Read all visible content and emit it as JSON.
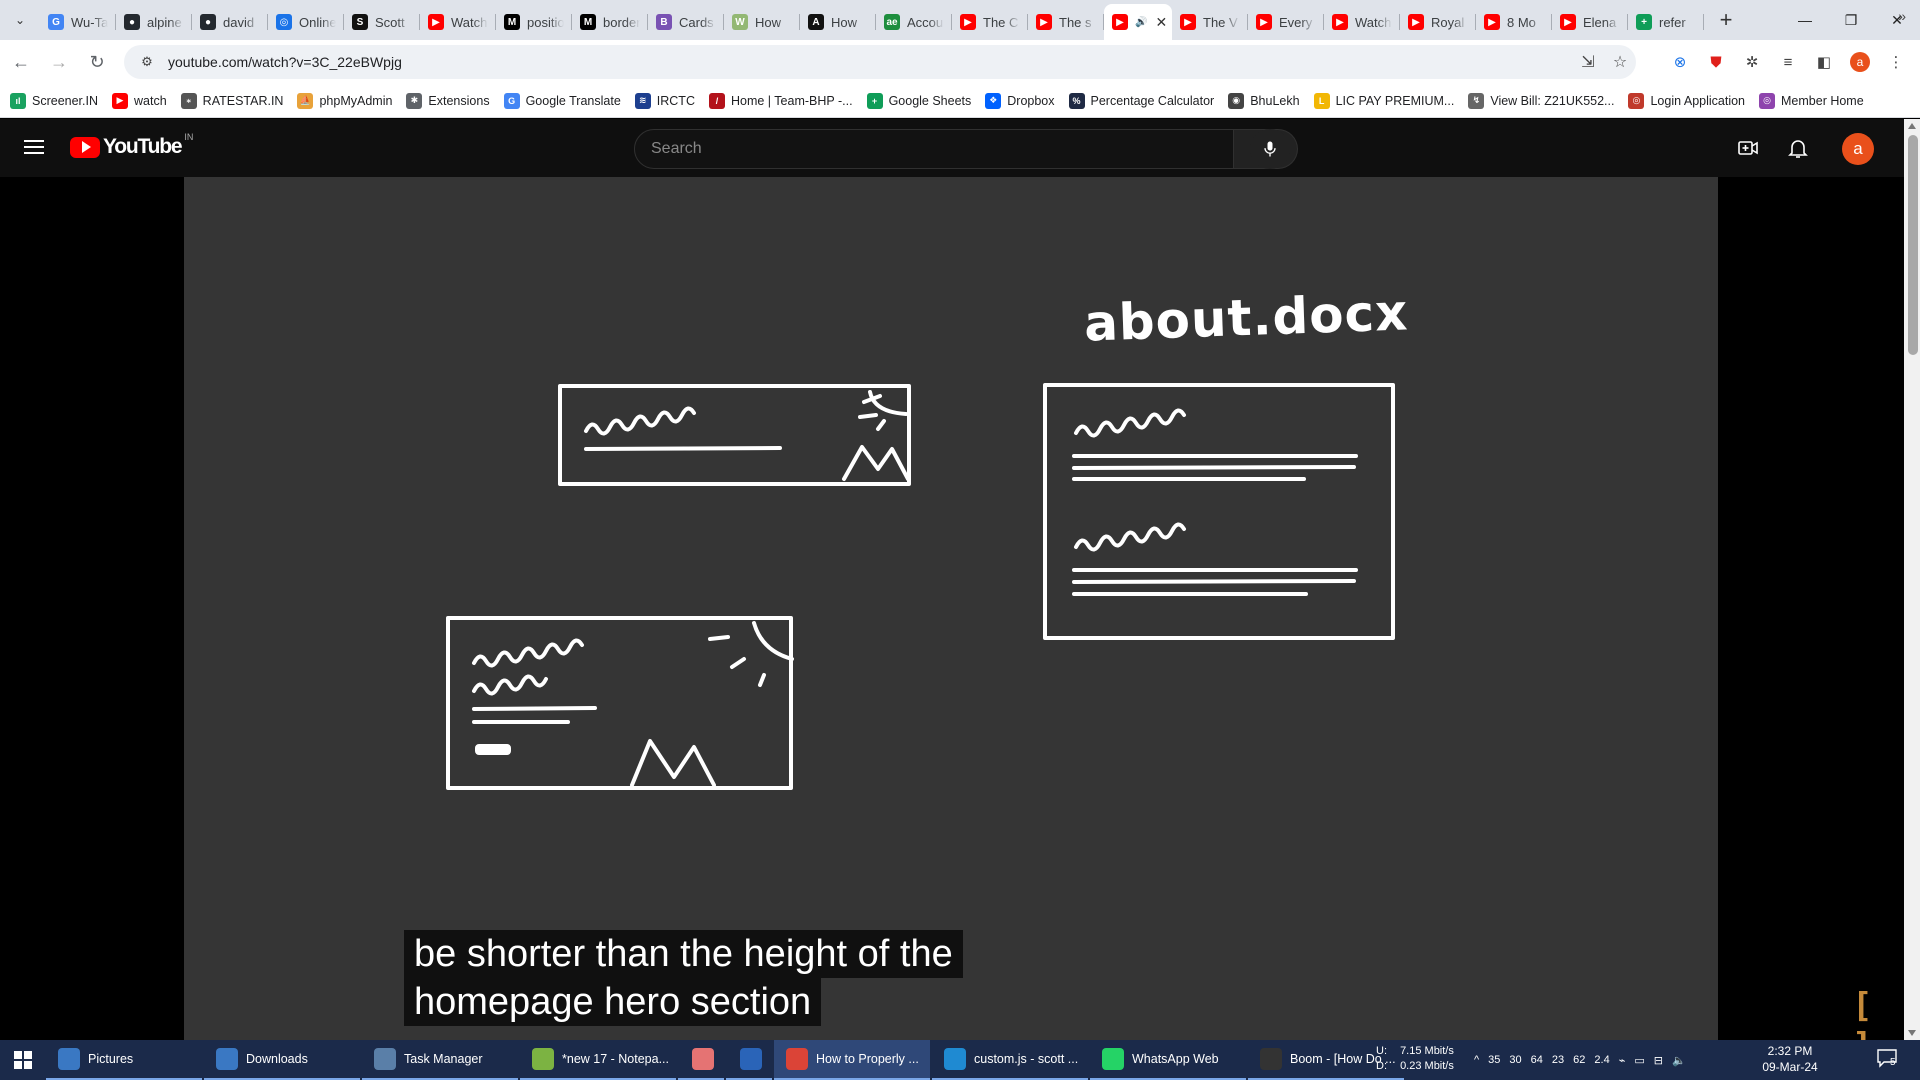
{
  "browser": {
    "tabs": [
      {
        "title": "Wu-Tang",
        "icon": "google-icon",
        "color": "#4285f4",
        "glyph": "G"
      },
      {
        "title": "alpine",
        "icon": "github-icon",
        "color": "#24292f",
        "glyph": "●"
      },
      {
        "title": "david",
        "icon": "github-icon",
        "color": "#24292f",
        "glyph": "●"
      },
      {
        "title": "Online",
        "icon": "globe-icon",
        "color": "#1a73e8",
        "glyph": "◎"
      },
      {
        "title": "Scott",
        "icon": "s-icon",
        "color": "#111111",
        "glyph": "S"
      },
      {
        "title": "Watch",
        "icon": "youtube-icon",
        "color": "#ff0000",
        "glyph": "▶"
      },
      {
        "title": "position",
        "icon": "mdn-icon",
        "color": "#000000",
        "glyph": "M"
      },
      {
        "title": "border",
        "icon": "mdn-icon",
        "color": "#000000",
        "glyph": "M"
      },
      {
        "title": "Cards",
        "icon": "bootstrap-icon",
        "color": "#7952b3",
        "glyph": "B"
      },
      {
        "title": "How",
        "icon": "wikihow-icon",
        "color": "#93b874",
        "glyph": "W"
      },
      {
        "title": "How",
        "icon": "a-icon",
        "color": "#111111",
        "glyph": "A"
      },
      {
        "title": "Account",
        "icon": "ge-icon",
        "color": "#1e8e3e",
        "glyph": "ae"
      },
      {
        "title": "The C",
        "icon": "youtube-icon",
        "color": "#ff0000",
        "glyph": "▶"
      },
      {
        "title": "The s",
        "icon": "youtube-icon",
        "color": "#ff0000",
        "glyph": "▶"
      },
      {
        "title": "",
        "icon": "youtube-icon",
        "color": "#ff0000",
        "glyph": "▶",
        "active": true
      },
      {
        "title": "The V",
        "icon": "youtube-icon",
        "color": "#ff0000",
        "glyph": "▶"
      },
      {
        "title": "Every",
        "icon": "youtube-icon",
        "color": "#ff0000",
        "glyph": "▶"
      },
      {
        "title": "Watch",
        "icon": "youtube-icon",
        "color": "#ff0000",
        "glyph": "▶"
      },
      {
        "title": "Royal",
        "icon": "youtube-icon",
        "color": "#ff0000",
        "glyph": "▶"
      },
      {
        "title": "8 Mo",
        "icon": "youtube-icon",
        "color": "#ff0000",
        "glyph": "▶"
      },
      {
        "title": "Elena",
        "icon": "youtube-icon",
        "color": "#ff0000",
        "glyph": "▶"
      },
      {
        "title": "refer",
        "icon": "sheets-icon",
        "color": "#0f9d58",
        "glyph": "+"
      }
    ],
    "url": "youtube.com/watch?v=3C_22eBWpjg",
    "profile_initial": "a",
    "bookmarks": [
      {
        "label": "Screener.IN",
        "icon": "bar-chart-icon",
        "color": "#1aa260",
        "glyph": "ıl"
      },
      {
        "label": "watch",
        "icon": "youtube-icon",
        "color": "#ff0000",
        "glyph": "▶"
      },
      {
        "label": "RATESTAR.IN",
        "icon": "star-icon",
        "color": "#555555",
        "glyph": "⁎"
      },
      {
        "label": "phpMyAdmin",
        "icon": "phpmyadmin-icon",
        "color": "#e8a23a",
        "glyph": "⛵"
      },
      {
        "label": "Extensions",
        "icon": "puzzle-icon",
        "color": "#5f6368",
        "glyph": "✱"
      },
      {
        "label": "Google Translate",
        "icon": "translate-icon",
        "color": "#4285f4",
        "glyph": "G"
      },
      {
        "label": "IRCTC",
        "icon": "irctc-icon",
        "color": "#1d3f8f",
        "glyph": "≋"
      },
      {
        "label": "Home | Team-BHP -...",
        "icon": "teambhp-icon",
        "color": "#b3121b",
        "glyph": "/"
      },
      {
        "label": "Google Sheets",
        "icon": "sheets-icon",
        "color": "#0f9d58",
        "glyph": "+"
      },
      {
        "label": "Dropbox",
        "icon": "dropbox-icon",
        "color": "#0061fe",
        "glyph": "❖"
      },
      {
        "label": "Percentage Calculator",
        "icon": "percent-icon",
        "color": "#1f2a44",
        "glyph": "%"
      },
      {
        "label": "BhuLekh",
        "icon": "bhulekh-icon",
        "color": "#444444",
        "glyph": "◉"
      },
      {
        "label": "LIC PAY PREMIUM...",
        "icon": "lic-icon",
        "color": "#f2b705",
        "glyph": "L"
      },
      {
        "label": "View Bill: Z21UK552...",
        "icon": "bill-icon",
        "color": "#666666",
        "glyph": "↯"
      },
      {
        "label": "Login Application",
        "icon": "login-icon",
        "color": "#c0392b",
        "glyph": "◎"
      },
      {
        "label": "Member Home",
        "icon": "member-icon",
        "color": "#8e44ad",
        "glyph": "◎"
      }
    ]
  },
  "youtube": {
    "country": "IN",
    "search_placeholder": "Search",
    "avatar_initial": "a"
  },
  "video": {
    "drawing_title": "about.docx",
    "caption_lines": [
      "be shorter than the height of the",
      "homepage hero section"
    ],
    "overlay_glyph": "[ ]"
  },
  "taskbar": {
    "items": [
      {
        "label": "Pictures",
        "icon": "folder-icon",
        "color": "#3a78c3"
      },
      {
        "label": "Downloads",
        "icon": "download-icon",
        "color": "#3a78c3"
      },
      {
        "label": "Task Manager",
        "icon": "task-manager-icon",
        "color": "#5a7fa8"
      },
      {
        "label": "*new 17 - Notepa...",
        "icon": "notepad-icon",
        "color": "#7cb342"
      },
      {
        "label": "",
        "icon": "app-icon",
        "color": "#e57373",
        "small": true
      },
      {
        "label": "",
        "icon": "doc-icon",
        "color": "#2a64b8",
        "small": true
      },
      {
        "label": "How to Properly ...",
        "icon": "chrome-icon",
        "color": "#db4437",
        "active": true
      },
      {
        "label": "custom.js - scott ...",
        "icon": "vscode-icon",
        "color": "#1f8ad2"
      },
      {
        "label": "WhatsApp Web",
        "icon": "whatsapp-icon",
        "color": "#25d366"
      },
      {
        "label": "Boom - [How Do ...",
        "icon": "boom-icon",
        "color": "#333333"
      }
    ],
    "net_up_label": "U:",
    "net_up": "7.15 Mbit/s",
    "net_down_label": "D:",
    "net_down": "0.23 Mbit/s",
    "tray": [
      "^",
      "35",
      "30",
      "64",
      "23",
      "62",
      "2.4"
    ],
    "time": "2:32 PM",
    "date": "09-Mar-24",
    "notifications": "5"
  }
}
